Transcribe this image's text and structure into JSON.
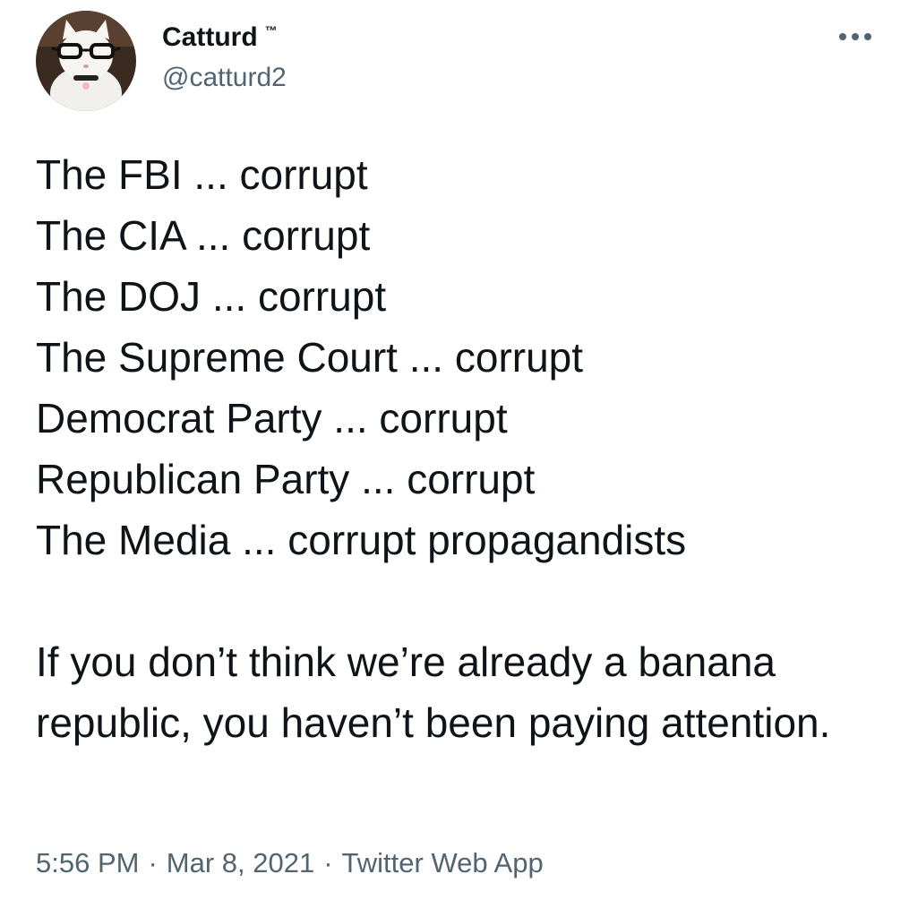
{
  "tweet": {
    "author": {
      "display_name": "Catturd",
      "badge": "™",
      "handle": "@catturd2",
      "avatar_icon": "cat-with-glasses-avatar"
    },
    "more_icon": "more-horizontal-icon",
    "lines": [
      "The FBI ... corrupt",
      "The CIA ... corrupt",
      "The DOJ ... corrupt",
      "The Supreme Court ... corrupt",
      "Democrat Party ... corrupt",
      "Republican Party ... corrupt",
      "The Media ... corrupt propagandists"
    ],
    "closing": "If you don’t think we’re already a banana republic, you haven’t been paying attention.",
    "time": "5:56 PM",
    "separator": "·",
    "date": "Mar 8, 2021",
    "source": "Twitter Web App"
  },
  "colors": {
    "text": "#0f1419",
    "secondary": "#536471",
    "background": "#ffffff"
  }
}
